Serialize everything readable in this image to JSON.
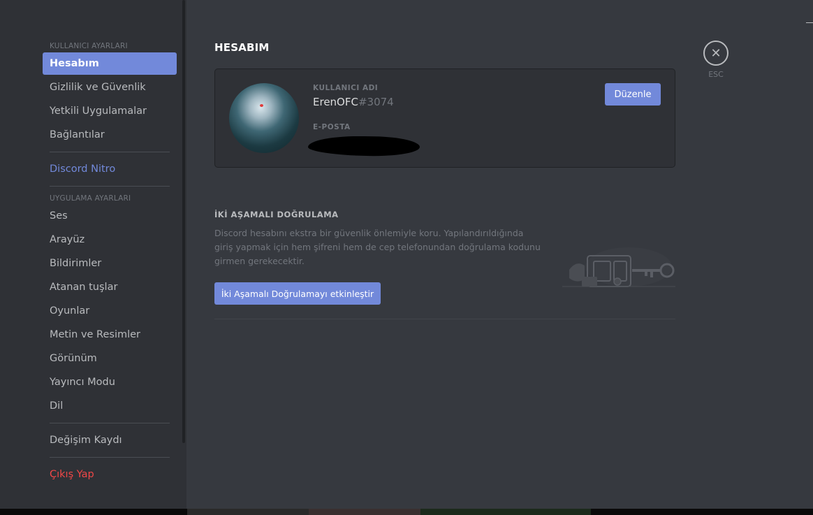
{
  "sidebar": {
    "user_settings_header": "KULLANICI AYARLARI",
    "user_items": [
      {
        "label": "Hesabım"
      },
      {
        "label": "Gizlilik ve Güvenlik"
      },
      {
        "label": "Yetkili Uygulamalar"
      },
      {
        "label": "Bağlantılar"
      }
    ],
    "nitro_label": "Discord Nitro",
    "app_settings_header": "UYGULAMA AYARLARI",
    "app_items": [
      {
        "label": "Ses"
      },
      {
        "label": "Arayüz"
      },
      {
        "label": "Bildirimler"
      },
      {
        "label": "Atanan tuşlar"
      },
      {
        "label": "Oyunlar"
      },
      {
        "label": "Metin ve Resimler"
      },
      {
        "label": "Görünüm"
      },
      {
        "label": "Yayıncı Modu"
      },
      {
        "label": "Dil"
      }
    ],
    "changelog_label": "Değişim Kaydı",
    "logout_label": "Çıkış Yap"
  },
  "main": {
    "title": "HESABIM",
    "account": {
      "username_label": "KULLANICI ADI",
      "username": "ErenOFC",
      "discriminator": "#3074",
      "email_label": "E-POSTA",
      "edit_button": "Düzenle"
    },
    "two_factor": {
      "title": "İKİ AŞAMALI DOĞRULAMA",
      "description": "Discord hesabını ekstra bir güvenlik önlemiyle koru. Yapılandırıldığında giriş yapmak için hem şifreni hem de cep telefonundan doğrulama kodunu girmen gerekecektir.",
      "button": "İki Aşamalı Doğrulamayı etkinleştir"
    }
  },
  "close": {
    "icon": "close-icon",
    "label": "ESC"
  },
  "colors": {
    "accent": "#7289da",
    "danger": "#f04747",
    "background": "#36393f",
    "sidebar": "#2f3136"
  }
}
